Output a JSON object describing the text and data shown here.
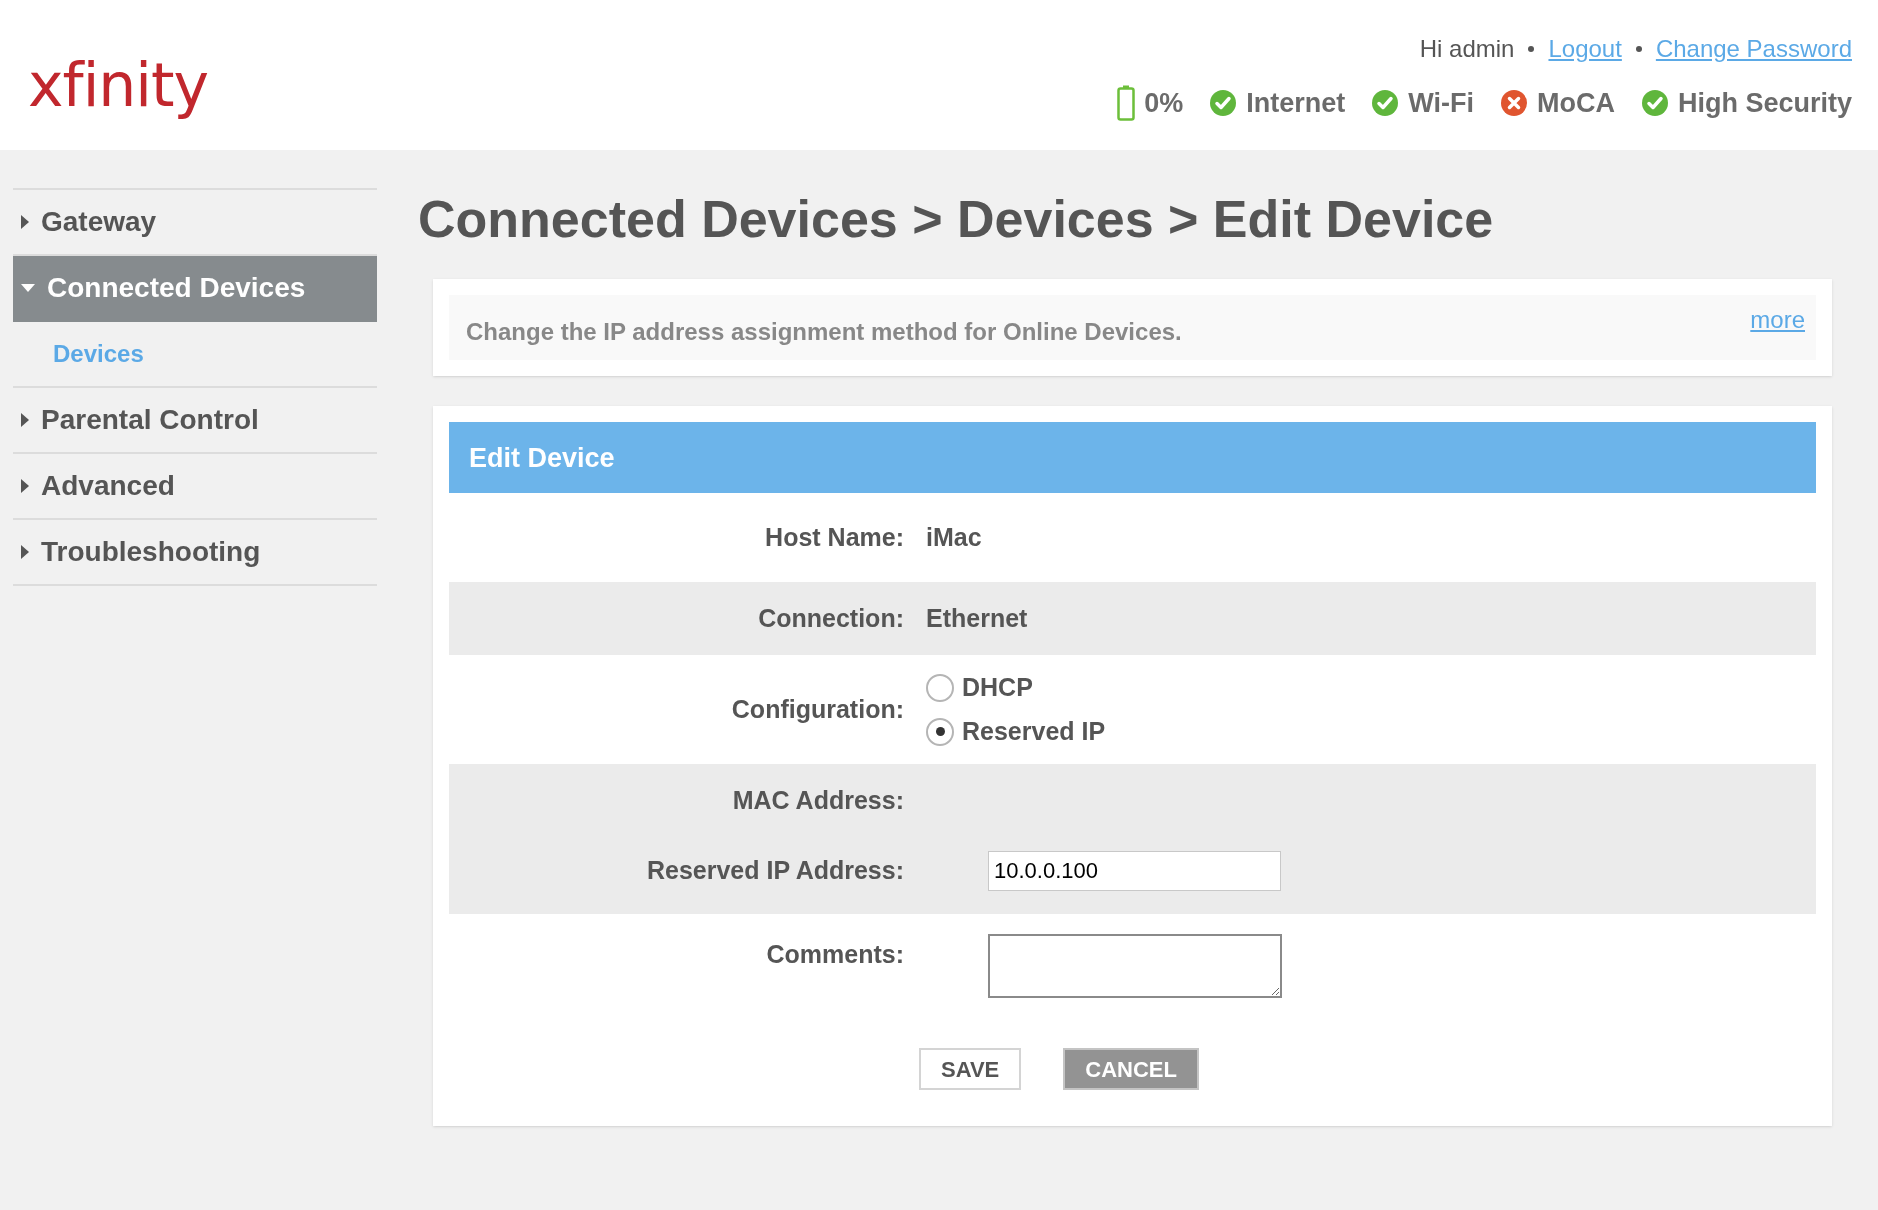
{
  "header": {
    "logo": "xfinity",
    "greeting": "Hi admin",
    "links": [
      {
        "label": "Logout"
      },
      {
        "label": "Change Password"
      }
    ],
    "status": [
      {
        "kind": "battery",
        "label": "0%"
      },
      {
        "kind": "ok",
        "label": "Internet"
      },
      {
        "kind": "ok",
        "label": "Wi-Fi"
      },
      {
        "kind": "error",
        "label": "MoCA"
      },
      {
        "kind": "ok",
        "label": "High Security"
      }
    ]
  },
  "sidebar": {
    "items": [
      {
        "label": "Gateway",
        "expanded": false,
        "selected": false
      },
      {
        "label": "Connected Devices",
        "expanded": true,
        "selected": true,
        "children": [
          {
            "label": "Devices",
            "selected": true
          }
        ]
      },
      {
        "label": "Parental Control",
        "expanded": false,
        "selected": false
      },
      {
        "label": "Advanced",
        "expanded": false,
        "selected": false
      },
      {
        "label": "Troubleshooting",
        "expanded": false,
        "selected": false
      }
    ]
  },
  "page_title": "Connected Devices > Devices > Edit Device",
  "info": {
    "text": "Change the IP address assignment method for Online Devices.",
    "more": "more"
  },
  "form": {
    "title": "Edit Device",
    "rows": [
      {
        "kind": "text",
        "label": "Host Name:",
        "value": "iMac",
        "shaded": false
      },
      {
        "kind": "text",
        "label": "Connection:",
        "value": "Ethernet",
        "shaded": true
      },
      {
        "kind": "radio",
        "label": "Configuration:",
        "shaded": false,
        "options": [
          {
            "label": "DHCP",
            "selected": false
          },
          {
            "label": "Reserved IP",
            "selected": true
          }
        ]
      },
      {
        "kind": "text",
        "label": "MAC Address:",
        "shaded": true
      },
      {
        "kind": "input",
        "label": "Reserved IP Address:",
        "value": "10.0.0.100",
        "shaded": true
      },
      {
        "kind": "textarea",
        "label": "Comments:",
        "shaded": false
      }
    ],
    "buttons": [
      {
        "label": "SAVE",
        "kind": "secondary"
      },
      {
        "label": "CANCEL",
        "kind": "primary"
      }
    ]
  }
}
